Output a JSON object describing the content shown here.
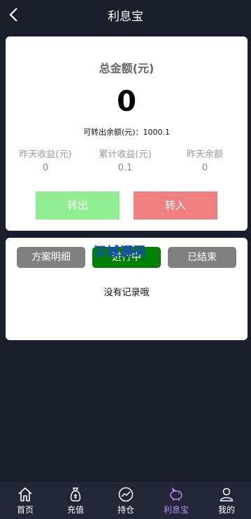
{
  "header": {
    "title": "利息宝"
  },
  "summary": {
    "total_label": "总金额(元)",
    "total_value": "0",
    "transferable": "可转出余额(元)：1000.1",
    "stats": [
      {
        "label": "昨天收益(元)",
        "value": "0"
      },
      {
        "label": "累计收益(元)",
        "value": "0.1"
      },
      {
        "label": "昨天余额",
        "value": "0"
      }
    ],
    "transfer_out_label": "转出",
    "transfer_in_label": "转入"
  },
  "records": {
    "tabs": [
      "方案明细",
      "进行中",
      "已结束"
    ],
    "watermark": "汉城源码",
    "empty_text": "没有记录哦"
  },
  "nav": {
    "items": [
      {
        "label": "首页",
        "icon": "home-icon"
      },
      {
        "label": "充值",
        "icon": "money-bag-icon"
      },
      {
        "label": "持仓",
        "icon": "chart-icon"
      },
      {
        "label": "利息宝",
        "icon": "piggy-bank-icon"
      },
      {
        "label": "我的",
        "icon": "user-icon"
      }
    ],
    "active_index": 3
  },
  "colors": {
    "background": "#1a1d2a",
    "transfer_out": "#90ee90",
    "transfer_in": "#f08080",
    "tab_active": "#008000",
    "tab_inactive": "#808080",
    "nav_active": "#b58cf0"
  }
}
